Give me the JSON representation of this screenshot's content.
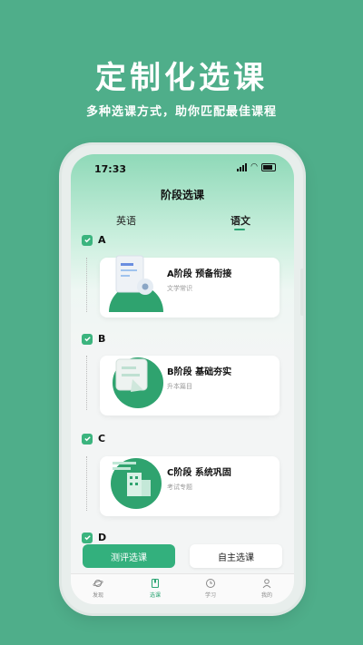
{
  "promo": {
    "title": "定制化选课",
    "subtitle": "多种选课方式，助你匹配最佳课程"
  },
  "status_bar": {
    "time": "17:33"
  },
  "header": {
    "title": "阶段选课"
  },
  "tabs": [
    {
      "label": "英语",
      "active": false
    },
    {
      "label": "语文",
      "active": true
    }
  ],
  "sections": [
    {
      "letter": "A",
      "card": {
        "title": "A阶段 预备衔接",
        "subtitle": "文学常识"
      }
    },
    {
      "letter": "B",
      "card": {
        "title": "B阶段 基础夯实",
        "subtitle": "升本篇目"
      }
    },
    {
      "letter": "C",
      "card": {
        "title": "C阶段 系统巩固",
        "subtitle": "考试专题"
      }
    },
    {
      "letter": "D"
    }
  ],
  "actions": {
    "test_label": "测评选课",
    "self_label": "自主选课"
  },
  "tabbar": [
    {
      "label": "发现",
      "icon": "planet-icon",
      "active": false
    },
    {
      "label": "选课",
      "icon": "book-icon",
      "active": true
    },
    {
      "label": "学习",
      "icon": "clock-icon",
      "active": false
    },
    {
      "label": "我的",
      "icon": "person-icon",
      "active": false
    }
  ],
  "colors": {
    "brand_green": "#4fae8a",
    "accent": "#33b07d"
  }
}
